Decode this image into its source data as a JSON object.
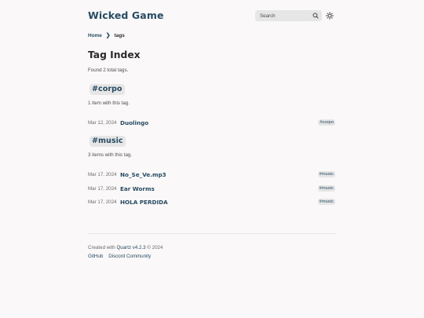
{
  "site": {
    "title": "Wicked Game"
  },
  "search": {
    "placeholder": "Search"
  },
  "breadcrumb": {
    "home": "Home",
    "separator": "❯",
    "current": "tags"
  },
  "page": {
    "title": "Tag Index",
    "found_text": "Found 2 total tags."
  },
  "tags": [
    {
      "name": "#corpo",
      "count_text": "1 item with this tag.",
      "items": [
        {
          "date": "Mar 12, 2024",
          "title": "Duolingo",
          "tag": "#corpo"
        }
      ]
    },
    {
      "name": "#music",
      "count_text": "3 items with this tag.",
      "items": [
        {
          "date": "Mar 17, 2024",
          "title": "No_Se_Ve.mp3",
          "tag": "#music"
        },
        {
          "date": "Mar 17, 2024",
          "title": "Ear Worms",
          "tag": "#music"
        },
        {
          "date": "Mar 17, 2024",
          "title": "HOLA PERDIDA",
          "tag": "#music"
        }
      ]
    }
  ],
  "footer": {
    "created_prefix": "Created with ",
    "quartz": "Quartz v4.2.3",
    "suffix": " © 2024",
    "links": [
      "GitHub",
      "Discord Community"
    ]
  },
  "colors": {
    "accent": "#284b63",
    "background": "#faf8f8",
    "highlight": "#e6e6e6"
  },
  "icons": {
    "search": "search-icon",
    "darkmode": "sun-icon"
  }
}
